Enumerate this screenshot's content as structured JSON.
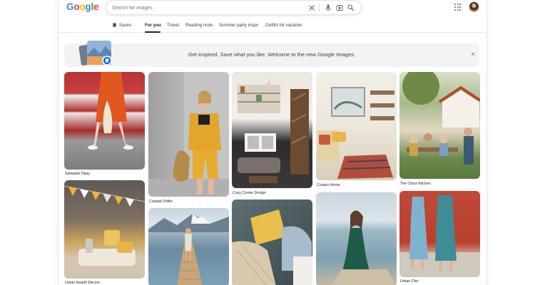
{
  "header": {
    "logo_letters": [
      "G",
      "o",
      "o",
      "g",
      "l",
      "e"
    ],
    "logo_colors": [
      "#4285F4",
      "#EA4335",
      "#FBBC05",
      "#4285F4",
      "#34A853",
      "#EA4335"
    ],
    "search_placeholder": "Search for images"
  },
  "tabs": [
    {
      "label": "Saves"
    },
    {
      "label": "For you"
    },
    {
      "label": "Travel"
    },
    {
      "label": "Reading nook"
    },
    {
      "label": "Summer party inspo"
    },
    {
      "label": "Outfits for vacation"
    }
  ],
  "banner": {
    "text": "Get inspired. Save what you like. Welcome to the new Google Images.",
    "close": "×"
  },
  "captions": {
    "c1": "Saltwater Diary",
    "c2": "Coastal Drifter",
    "c3": "Cozy Corner Design",
    "c4": "Curator Home",
    "c5": "The Citrus Kitchen",
    "c6": "Urban Hearth Decors",
    "c10": "Urban Chic"
  },
  "colors": {
    "accent": "#1a73e8",
    "text": "#202124"
  }
}
